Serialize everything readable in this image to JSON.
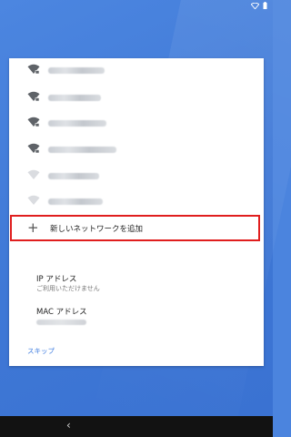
{
  "status_bar": {
    "icons": [
      "wifi-icon",
      "battery-icon"
    ]
  },
  "networks": [
    {
      "ssid": "",
      "secured": true
    },
    {
      "ssid": "",
      "secured": true
    },
    {
      "ssid": "",
      "secured": true
    },
    {
      "ssid": "",
      "secured": true
    },
    {
      "ssid": "",
      "secured": false
    },
    {
      "ssid": "",
      "secured": false
    },
    {
      "ssid": "",
      "secured": false
    }
  ],
  "add_network": {
    "icon": "plus-icon",
    "label": "新しいネットワークを追加"
  },
  "ip_address": {
    "title": "IP アドレス",
    "value": "ご利用いただけません"
  },
  "mac_address": {
    "title": "MAC アドレス"
  },
  "skip_label": "スキップ",
  "nav_bar": {
    "back_glyph": "‹"
  },
  "colors": {
    "background": "#4b84de",
    "accent": "#3f7de0",
    "highlight": "#e01e1e"
  }
}
